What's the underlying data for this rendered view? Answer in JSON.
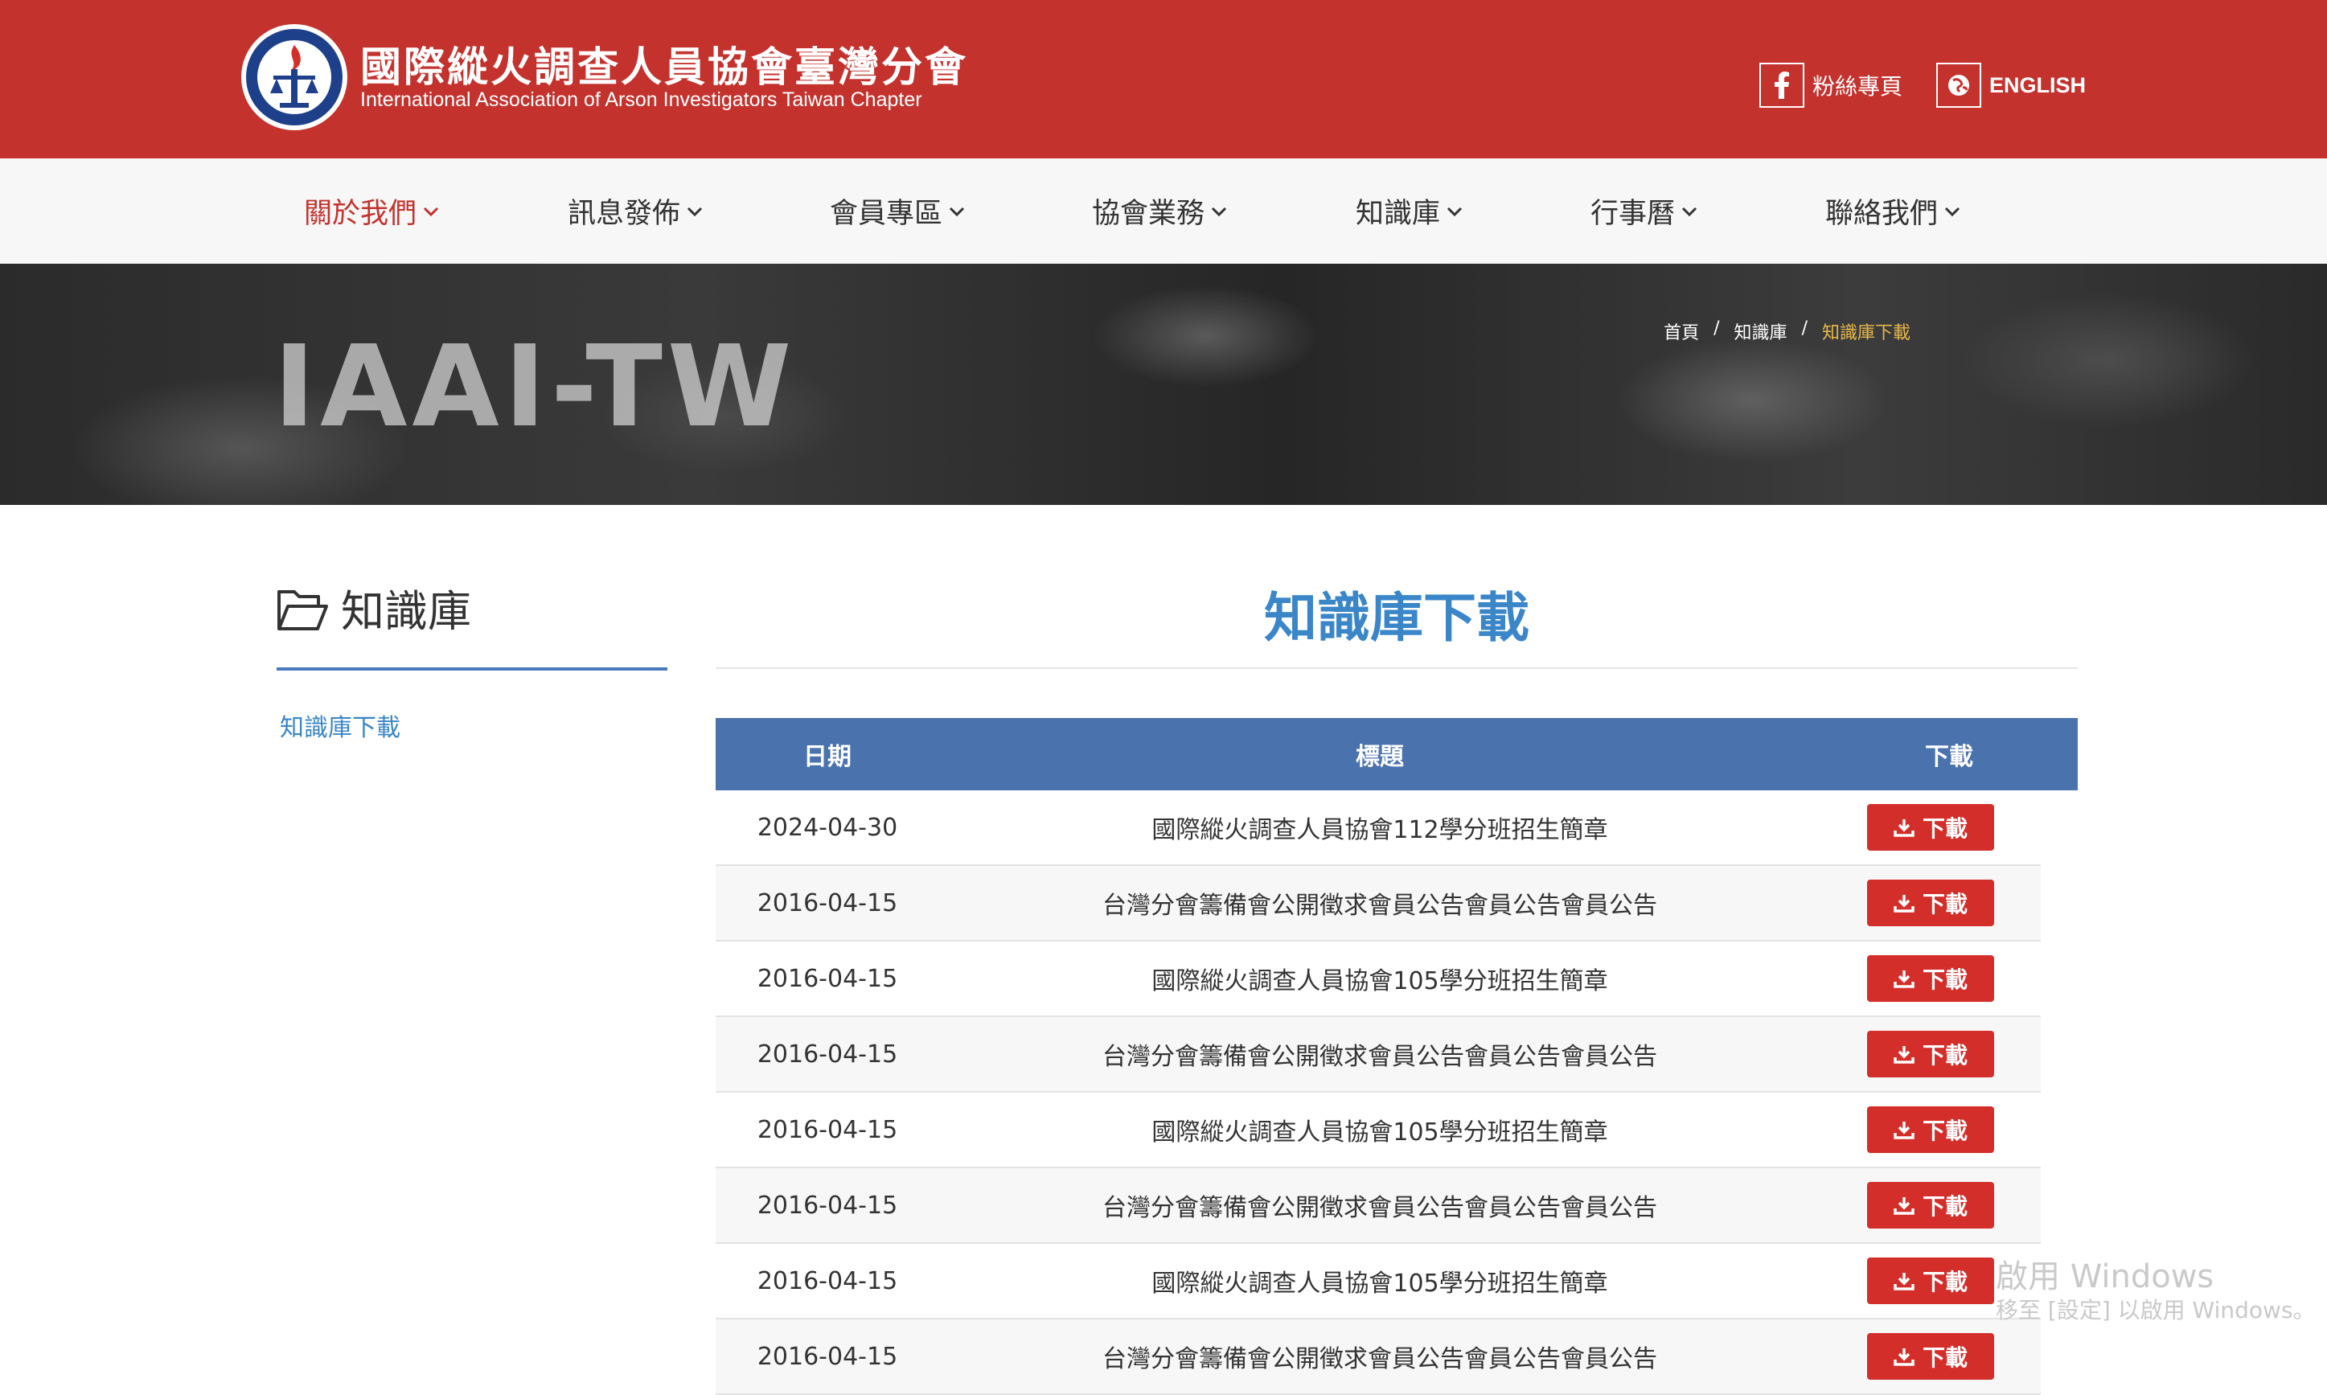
{
  "header": {
    "title_zh": "國際縱火調查人員協會臺灣分會",
    "title_en": "International Association of Arson Investigators Taiwan Chapter",
    "facebook_label": "粉絲專頁",
    "language_label": "ENGLISH",
    "brand_color": "#c4322e"
  },
  "nav": {
    "items": [
      {
        "label": "關於我們",
        "active": true
      },
      {
        "label": "訊息發佈"
      },
      {
        "label": "會員專區"
      },
      {
        "label": "協會業務"
      },
      {
        "label": "知識庫"
      },
      {
        "label": "行事曆"
      },
      {
        "label": "聯絡我們"
      }
    ]
  },
  "banner": {
    "text": "IAAI-TW",
    "breadcrumb": [
      "首頁",
      "知識庫",
      "知識庫下載"
    ]
  },
  "sidebar": {
    "title": "知識庫",
    "links": [
      "知識庫下載"
    ],
    "icon": "folder-open-icon"
  },
  "main": {
    "title": "知識庫下載",
    "accent_color": "#3a86c8"
  },
  "table": {
    "headers": [
      "日期",
      "標題",
      "下載"
    ],
    "download_label": "下載",
    "rows": [
      {
        "date": "2024-04-30",
        "title": "國際縱火調查人員協會112學分班招生簡章"
      },
      {
        "date": "2016-04-15",
        "title": "台灣分會籌備會公開徵求會員公告會員公告會員公告"
      },
      {
        "date": "2016-04-15",
        "title": "國際縱火調查人員協會105學分班招生簡章"
      },
      {
        "date": "2016-04-15",
        "title": "台灣分會籌備會公開徵求會員公告會員公告會員公告"
      },
      {
        "date": "2016-04-15",
        "title": "國際縱火調查人員協會105學分班招生簡章"
      },
      {
        "date": "2016-04-15",
        "title": "台灣分會籌備會公開徵求會員公告會員公告會員公告"
      },
      {
        "date": "2016-04-15",
        "title": "國際縱火調查人員協會105學分班招生簡章"
      },
      {
        "date": "2016-04-15",
        "title": "台灣分會籌備會公開徵求會員公告會員公告會員公告"
      }
    ]
  },
  "watermark": {
    "line1": "啟用 Windows",
    "line2": "移至 [設定] 以啟用 Windows。"
  }
}
